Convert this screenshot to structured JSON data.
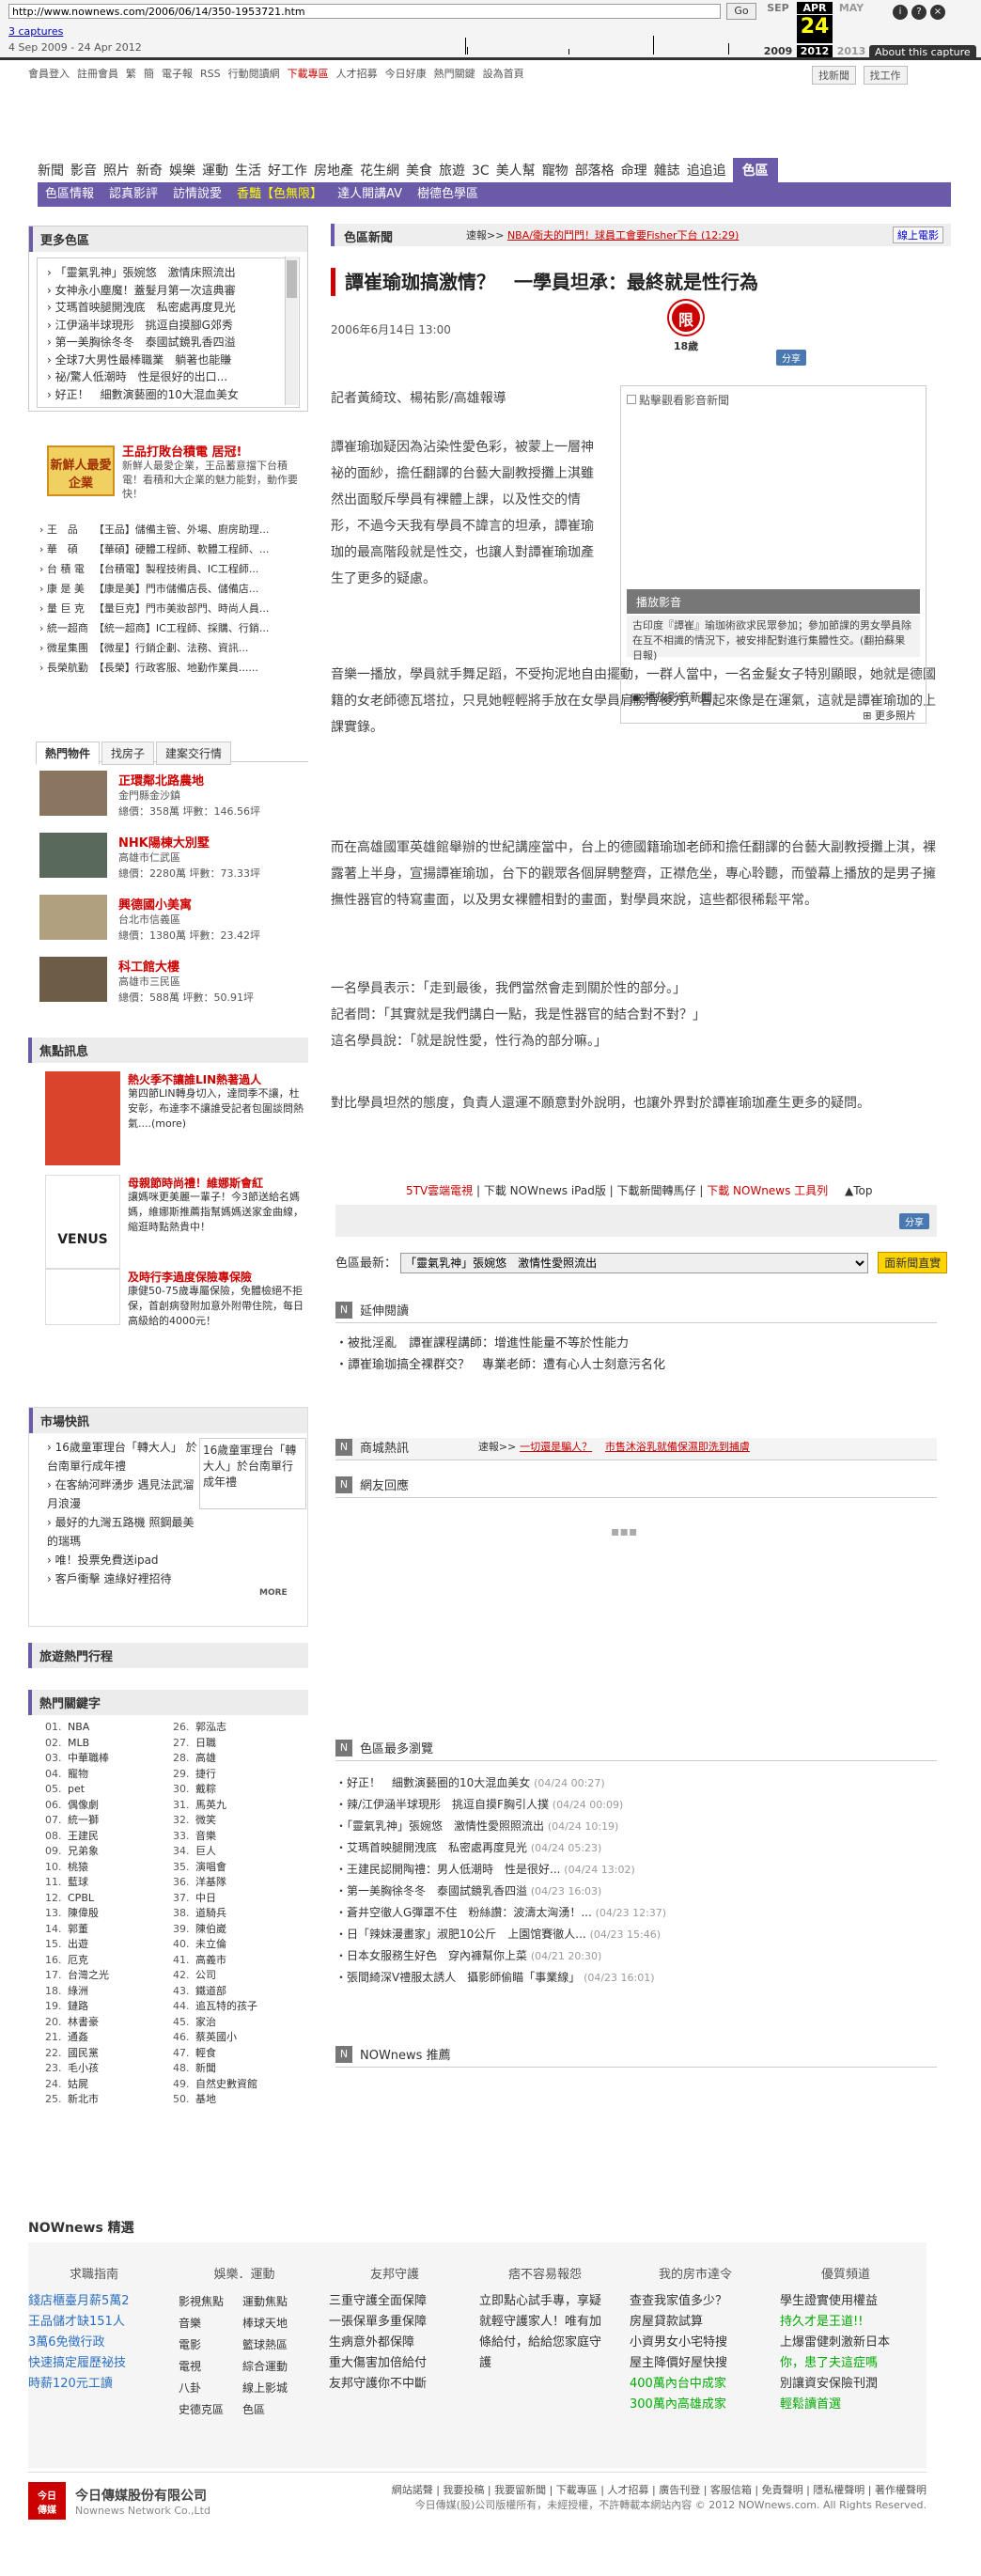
{
  "wayback": {
    "url": "http://www.nownews.com/2006/06/14/350-1953721.htm",
    "go": "Go",
    "captures": "3 captures",
    "span": "4 Sep 2009 - 24 Apr 2012",
    "months": [
      "SEP",
      "APR",
      "MAY"
    ],
    "day": "24",
    "years": [
      "2009",
      "2012",
      "2013"
    ],
    "about": "About this capture"
  },
  "toplinks": [
    "會員登入",
    "註冊會員",
    "繁",
    "簡",
    "電子報",
    "RSS",
    "行動閱讀網",
    "下載專區",
    "人才招募",
    "今日好康",
    "熱門關鍵",
    "設為首頁"
  ],
  "topright": {
    "search": "找新聞",
    "work": "找工作"
  },
  "nav": [
    "新聞",
    "影音",
    "照片",
    "新奇",
    "娛樂",
    "運動",
    "生活",
    "好工作",
    "房地產",
    "花生網",
    "美食",
    "旅遊",
    "3C",
    "美人幫",
    "寵物",
    "部落格",
    "命理",
    "雜誌",
    "追追追",
    "色區"
  ],
  "subnav": [
    "色區情報",
    "認真影評",
    "訪情說愛",
    "香豔【色無限】",
    "達人開講AV",
    "樹德色學區"
  ],
  "left": {
    "more_title": "更多色區",
    "more_items": [
      "「靈氣乳神」張婉悠　激情床照流出",
      "女神永小塵魔！蓋髮月第一次這典審",
      "艾瑪首映腿開洩底　私密處再度見光",
      "江伊涵半球現形　挑逗自摸腳G郊秀",
      "第一美胸徐冬冬　泰國試鏡乳香四溢",
      "全球7大男性最棒職業　躺著也能賺",
      "祕/驚人低潮時　性是很好的出口...",
      "好正！　細數演藝圈的10大混血美女"
    ],
    "ad_title": "王品打敗台積電 居冠!",
    "ad_logo": "新鮮人最愛企業",
    "ad_text": [
      "新鮮人最愛企業，王品蓄意擋下台積電！看積和大企業的魅力能對，動作要快！"
    ],
    "jobs": [
      [
        "王　品",
        "【王品】儲備主管、外場、廚房助理..."
      ],
      [
        "華　碩",
        "【華碩】硬體工程師、軟體工程師、..."
      ],
      [
        "台 積 電",
        "【台積電】製程技術員、IC工程師..."
      ],
      [
        "康 是 美",
        "【康是美】門市儲備店長、儲備店..."
      ],
      [
        "量 巨 克",
        "【量巨克】門市美妝部門、時尚人員..."
      ],
      [
        "統一超商",
        "【統一超商】IC工程師、採購、行銷..."
      ],
      [
        "微星集團",
        "【微星】行銷企劃、法務、資訊..."
      ],
      [
        "長榮航勤",
        "【長榮】行政客服、地勤作業員......"
      ]
    ],
    "tabs": [
      "熱門物件",
      "找房子",
      "建案交行情"
    ],
    "houses": [
      {
        "title": "正環鄰北路農地",
        "sub": "金門縣金沙鎮",
        "info": "總價：358萬 坪數：146.56坪"
      },
      {
        "title": "NHK陽棟大別墅",
        "sub": "高雄市仁武區",
        "info": "總價：2280萬 坪數：73.33坪"
      },
      {
        "title": "興德國小美寓",
        "sub": "台北市信義區",
        "info": "總價：1380萬 坪數：23.42坪"
      },
      {
        "title": "科工館大樓",
        "sub": "高雄市三民區",
        "info": "總價：588萬 坪數：50.91坪"
      }
    ],
    "focus_title": "焦點訊息",
    "focus": [
      {
        "title": "熱火季不讓誰LIN熱著過人",
        "text": "第四節LIN轉身切入，達問季不讓，杜安彰，布達李不讓誰受記者包圍談問熱氣....(more)"
      },
      {
        "title": "母親節時尚禮！維娜斯會紅",
        "text": "讓媽咪更美麗一輩子！今3節送給名媽媽，維娜斯推薦指幫媽媽送家金曲線，縮逛時點熱貴中！",
        "logo": "VENUS"
      },
      {
        "title": "及時行李過度保險專保險",
        "text": "康健50-75歲專屬保險，免體檢絕不拒保，首創病發附加意外附帶住院，每日高級給的4000元！"
      }
    ],
    "market_title": "市場快訊",
    "market": [
      "16歲童軍理台「轉大人」 於台南單行成年禮",
      "在客納河畔湧步 遇見法武溜月浪漫",
      "最好的九灣五路機 照鋼最美的瑞瑪",
      "唯！投票免費送ipad",
      "客戶衝擊 遠綠好裡招待"
    ],
    "market_img": "16歲童軍理台「轉大人」於台南單行成年禮",
    "market_more": "MORE",
    "travel_title": "旅遊熱門行程",
    "kw_title": "熱門關鍵字",
    "kw_left": [
      "NBA",
      "MLB",
      "中華職棒",
      "寵物",
      "pet",
      "偶像劇",
      "統一獅",
      "王建民",
      "兄弟象",
      "桃猿",
      "藍球",
      "CPBL",
      "陳偉殷",
      "郭董",
      "出遊",
      "厄克",
      "台灣之光",
      "綠洲",
      "鏈路",
      "林書豪",
      "通姦",
      "國民黨",
      "毛小孩",
      "姑屍",
      "新北市"
    ],
    "kw_right": [
      "郭泓志",
      "日職",
      "高雄",
      "捷行",
      "戴粽",
      "馬英九",
      "微笑",
      "音樂",
      "巨人",
      "演唱會",
      "洋基隊",
      "中日",
      "道騎兵",
      "陳伯崴",
      "未立倫",
      "高義市",
      "公司",
      "鐵道部",
      "追瓦特的孩子",
      "家治",
      "蔡英國小",
      "輕食",
      "新聞",
      "自然史數資館",
      "基地"
    ]
  },
  "article": {
    "crumb": "色區新聞",
    "ticker_label": "速報>>",
    "ticker": "NBA/衛夫的鬥門！球員工會要Fisher下台 (12:29)",
    "online": "線上電影",
    "title": "譚崔瑜珈搞激情？　一學員坦承：最終就是性行為",
    "date": "2006年6月14日 13:00",
    "rating_mark": "限",
    "rating_age": "18歲",
    "share": "分享",
    "byline": "記者黃綺玟、楊祐影/高雄報導",
    "paragraphs": [
      "譚崔瑜珈疑因為沾染性愛色彩，被蒙上一層神祕的面紗，擔任翻譯的台藝大副教授攤上淇雖然出面駁斥學員有裸體上課，以及性交的情形，不過今天我有學員不諱言的坦承，譚崔瑜珈的最高階段就是性交，也讓人對譚崔瑜珈產生了更多的疑慮。",
      "音樂一播放，學員就手舞足蹈，不受拘泥地自由擺動，一群人當中，一名金髮女子特別顯眼，她就是德國籍的女老師德瓦塔拉，只見她輕輕將手放在女學員肩膀骨後方，看起來像是在運氣，這就是譚崔瑜珈的上課實錄。",
      "而在高雄國軍英雄館舉辦的世紀講座當中，台上的德國籍瑜珈老師和擔任翻譯的台藝大副教授攤上淇，裸露著上半身，宣揚譚崔瑜珈，台下的觀眾各個屏騁整齊，正襟危坐，專心聆聽，而螢幕上播放的是男子擁撫性器官的特寫畫面，以及男女裸體相對的畫面，對學員來說，這些都很稀鬆平常。",
      "一名學員表示：「走到最後，我們當然會走到關於性的部分。」\n記者問：「其實就是我們講白一點，我是性器官的結合對不對？」\n這名學員說：「就是說性愛，性行為的部分嘛。」",
      "對比學員坦然的態度，負責人還運不願意對外說明，也讓外界對於譚崔瑜珈產生更多的疑問。"
    ],
    "video": {
      "ph": "點擊觀看影音新聞",
      "play": "播放影音",
      "cap": "古印度『譚崔』瑜珈術欲求民眾參加；參加節課的男女學員除在互不相識的情況下，被安排配對進行集體性交。(翻拍蘇果日報)",
      "link": "播放影音新聞",
      "more": "更多照片"
    },
    "bottomlinks": [
      "5TV雲端電視",
      "下載 NOWnews iPad版",
      "下載新聞轉馬仔",
      "下載 NOWnews 工具列",
      "▲Top"
    ],
    "latest_label": "色區最新：",
    "latest_option": "「靈氣乳神」張婉悠　激情性愛照流出",
    "latest_btn": "面新聞直實",
    "ext_title": "延伸閱讀",
    "ext": [
      "被批淫亂　譚崔課程講師：增進性能量不等於性能力",
      "譚崔瑜珈搞全裸群交？　專業老師：遭有心人士刻意污名化"
    ],
    "hot_title": "商城熱訊",
    "hot_label": "速報>>",
    "hot": [
      "一切還是騙人？",
      "市售沐浴乳就備保濕即洗到捕膚"
    ],
    "reply_title": "網友回應",
    "most_title": "色區最多瀏覽",
    "most": [
      [
        "好正！　細數演藝圈的10大混血美女",
        "(04/24 00:27)"
      ],
      [
        "辣/江伊涵半球現形　挑逗自摸F胸引人撲",
        "(04/24 00:09)"
      ],
      [
        "「靈氣乳神」張婉悠　激情性愛照照流出",
        "(04/24 10:19)"
      ],
      [
        "艾瑪首映腿開洩底　私密處再度見光",
        "(04/24 05:23)"
      ],
      [
        "王建民認開陶禮：男人低潮時　性是很好...",
        "(04/24 13:02)"
      ],
      [
        "第一美胸徐冬冬　泰國試鏡乳香四溢",
        "(04/23 16:03)"
      ],
      [
        "蒼井空徹人G彈罩不住　粉絲讚：波濤太洶湧！...",
        "(04/23 12:37)"
      ],
      [
        "日「辣妹漫畫家」淑肥10公斤　上園馆賽徹人...",
        "(04/23 15:46)"
      ],
      [
        "日本女服務生好色　穿內褲幫你上菜",
        "(04/21 20:30)"
      ],
      [
        "張間綺深V禮服太誘人　攝影師偷瞄「事業線」",
        "(04/23 16:01)"
      ]
    ],
    "rec_title": "NOWnews 推薦"
  },
  "jx": {
    "title": "NOWnews 精選",
    "cols": [
      {
        "head": "求職指南",
        "items": [
          "錢店櫃臺月薪5萬2",
          "王品儲才缺151人",
          "3萬6免徵行政",
          "快速搞定履歷祕技",
          "時薪120元工讀"
        ]
      },
      {
        "head": "娛樂．運動",
        "items": [
          "影視焦點",
          "運動焦點",
          "音樂",
          "棒球天地",
          "電影",
          "籃球熱區",
          "電視",
          "綜合運動",
          "八卦",
          "線上影城",
          "史德克區",
          "色區"
        ]
      },
      {
        "head": "友邦守護",
        "items": [
          "三重守護全面保障",
          "一張保單多重保障",
          "生病意外都保障",
          "重大傷害加倍給付",
          "友邦守護你不中斷"
        ]
      },
      {
        "head": "痞不容易報怨",
        "items": [
          "立即點心試手專，享疑就輕守護家人！唯有加條給付，給給您家庭守護"
        ]
      },
      {
        "head": "我的房市達令",
        "items": [
          "查查我家值多少？",
          "房屋貸款試算",
          "小資男女小宅特搜",
          "屋主降價好屋快搜",
          "400萬內台中成家",
          "300萬內高雄成家"
        ]
      },
      {
        "head": "優質頻道",
        "items": [
          "學生證實使用權益",
          "持久才是王道!!",
          "上爆雷健刺激新日本",
          "你，患了夫這症嗎",
          "別讓資安保險刊潤",
          "輕鬆讀首選"
        ]
      }
    ]
  },
  "footer": {
    "name": "今日傳媒股份有限公司",
    "name2": "Nownews Network Co.,Ltd",
    "links": "網站諾聲 | 我要投稿 | 我要留新聞 | 下載專區 | 人才招募 | 廣告刊登 | 客服信箱 | 免責聲明 | 隱私權聲明 | 著作權聲明",
    "copy": "今日傳媒(股)公司版權所有，未經授權，不許轉載本網站內容 © 2012 NOWnews.com. All Rights Reserved."
  }
}
